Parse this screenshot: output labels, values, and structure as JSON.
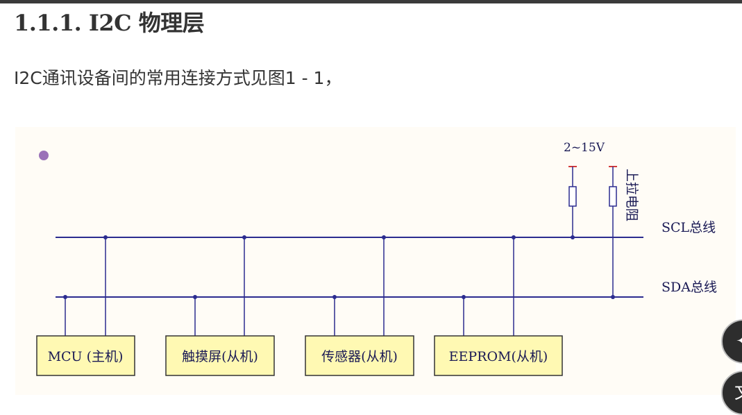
{
  "heading": "1.1.1. I2C 物理层",
  "intro": "I2C通讯设备间的常用连接方式见图1 - 1，",
  "diagram": {
    "voltage": "2~15V",
    "pullup_label": "上拉电阻",
    "scl_label": "SCL总线",
    "sda_label": "SDA总线",
    "devices": [
      "MCU (主机)",
      "触摸屏(从机)",
      "传感器(从机)",
      "EEPROM(从机)"
    ]
  },
  "colors": {
    "bus_line": "#2b2b8f",
    "device_fill": "#fff9b3",
    "resistor_top": "#d43a3a",
    "bullet": "#9b72b8"
  },
  "icons": [
    "sparkle-icon",
    "translate-icon"
  ]
}
